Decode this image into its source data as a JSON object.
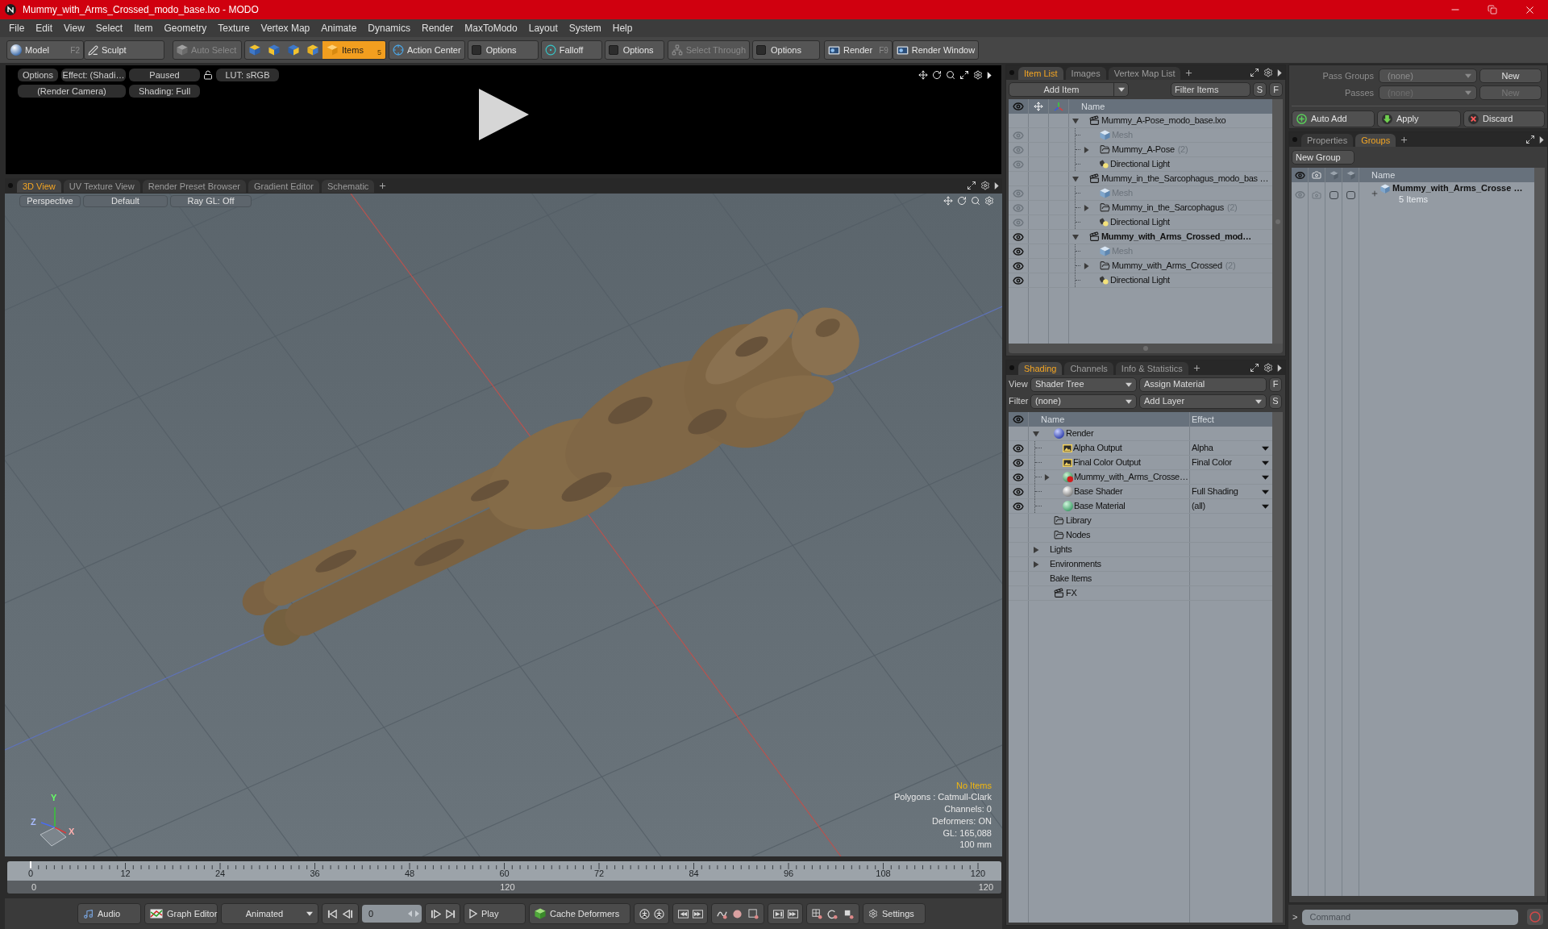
{
  "window": {
    "title": "Mummy_with_Arms_Crossed_modo_base.lxo - MODO"
  },
  "menu": [
    "File",
    "Edit",
    "View",
    "Select",
    "Item",
    "Geometry",
    "Texture",
    "Vertex Map",
    "Animate",
    "Dynamics",
    "Render",
    "MaxToModo",
    "Layout",
    "System",
    "Help"
  ],
  "toolbar": [
    {
      "kind": "button",
      "label": "Model",
      "shortcut": "F2",
      "disabled": false
    },
    {
      "kind": "button",
      "label": "Sculpt",
      "disabled": false
    },
    {
      "kind": "button",
      "label": "Auto Select",
      "disabled": true
    },
    {
      "kind": "modes",
      "items": [
        {
          "selected": false
        },
        {
          "selected": false
        },
        {
          "selected": false
        },
        {
          "selected": false
        },
        {
          "label": "Items",
          "shortcut": "5",
          "selected": true
        }
      ]
    },
    {
      "kind": "button",
      "label": "Action Center",
      "disabled": false
    },
    {
      "kind": "toggle",
      "label": "Options",
      "disabled": false
    },
    {
      "kind": "button",
      "label": "Falloff",
      "disabled": false
    },
    {
      "kind": "toggle",
      "label": "Options",
      "disabled": false
    },
    {
      "kind": "button",
      "label": "Select Through",
      "disabled": true
    },
    {
      "kind": "toggle",
      "label": "Options",
      "disabled": false
    },
    {
      "kind": "button",
      "label": "Render",
      "shortcut": "F9",
      "disabled": false
    },
    {
      "kind": "button",
      "label": "Render Window",
      "disabled": false
    }
  ],
  "preview": {
    "row_1": [
      "Options",
      "Effect: (Shadi…",
      "Paused",
      "LUT: sRGB"
    ],
    "row_2": [
      "(Render Camera)",
      "Shading: Full"
    ]
  },
  "viewport": {
    "tabs": [
      {
        "label": "3D View",
        "selected": true
      },
      {
        "label": "UV Texture View",
        "selected": false
      },
      {
        "label": "Render Preset Browser",
        "selected": false
      },
      {
        "label": "Gradient Editor",
        "selected": false
      },
      {
        "label": "Schematic",
        "selected": false
      }
    ],
    "view_bar": [
      "Perspective",
      "Default",
      "Ray GL: Off"
    ],
    "status": "No Items",
    "info": [
      "Polygons : Catmull-Clark",
      "Channels: 0",
      "Deformers: ON",
      "GL: 165,088",
      "100 mm"
    ],
    "axes": {
      "x": "X",
      "y": "Y",
      "z": "Z"
    }
  },
  "timeline": {
    "ticks": [
      "0",
      "12",
      "24",
      "36",
      "48",
      "60",
      "72",
      "84",
      "96",
      "108",
      "120"
    ],
    "range": [
      "0",
      "120",
      "120"
    ]
  },
  "playback": {
    "audio": "Audio",
    "graph_editor": "Graph Editor",
    "mode": "Animated",
    "frame": "0",
    "play": "Play",
    "cache": "Cache Deformers",
    "settings": "Settings"
  },
  "item_list": {
    "tabs": [
      {
        "label": "Item List",
        "selected": true
      },
      {
        "label": "Images",
        "selected": false
      },
      {
        "label": "Vertex Map List",
        "selected": false
      }
    ],
    "add_item": "Add Item",
    "filter": {
      "placeholder": "Filter Items"
    },
    "filter_buttons": [
      "S",
      "F"
    ],
    "column": "Name",
    "scenes": [
      {
        "label": "Mummy_A-Pose_modo_base.lxo",
        "current": false,
        "expanded": true,
        "children": [
          {
            "kind": "mesh",
            "label": "Mesh",
            "visible": false
          },
          {
            "kind": "group",
            "label": "Mummy_A-Pose",
            "count": "(2)",
            "expanded": false,
            "visible": false
          },
          {
            "kind": "light",
            "label": "Directional Light",
            "visible": false
          }
        ]
      },
      {
        "label": "Mummy_in_the_Sarcophagus_modo_bas …",
        "current": false,
        "expanded": true,
        "children": [
          {
            "kind": "mesh",
            "label": "Mesh",
            "visible": false
          },
          {
            "kind": "group",
            "label": "Mummy_in_the_Sarcophagus",
            "count": "(2)",
            "expanded": false,
            "visible": false
          },
          {
            "kind": "light",
            "label": "Directional Light",
            "visible": false
          }
        ]
      },
      {
        "label": "Mummy_with_Arms_Crossed_mod…",
        "current": true,
        "expanded": true,
        "children": [
          {
            "kind": "mesh",
            "label": "Mesh",
            "visible": true
          },
          {
            "kind": "group",
            "label": "Mummy_with_Arms_Crossed",
            "count": "(2)",
            "expanded": false,
            "visible": true
          },
          {
            "kind": "light",
            "label": "Directional Light",
            "visible": true
          }
        ]
      }
    ]
  },
  "shading": {
    "tabs": [
      {
        "label": "Shading",
        "selected": true
      },
      {
        "label": "Channels",
        "selected": false
      },
      {
        "label": "Info & Statistics",
        "selected": false
      }
    ],
    "view_label": "View",
    "view": "Shader Tree",
    "assign": "Assign Material",
    "view_button": "F",
    "filter_label": "Filter",
    "filter": "(none)",
    "add_layer": "Add Layer",
    "filter_button": "S",
    "columns": [
      "Name",
      "Effect"
    ],
    "rows": [
      {
        "kind": "render",
        "label": "Render",
        "expanded": true,
        "eye": false,
        "children": [
          {
            "kind": "output",
            "label": "Alpha Output",
            "effect": "Alpha",
            "eye": true
          },
          {
            "kind": "output",
            "label": "Final Color Output",
            "effect": "Final Color",
            "eye": true
          },
          {
            "kind": "material_group",
            "label": "Mummy_with_Arms_Crosse…",
            "expanded": false,
            "eye": true
          },
          {
            "kind": "shader",
            "label": "Base Shader",
            "effect": "Full Shading",
            "eye": true
          },
          {
            "kind": "material",
            "label": "Base Material",
            "effect": "(all)",
            "eye": true
          }
        ]
      },
      {
        "kind": "folder",
        "label": "Library",
        "eye": false
      },
      {
        "kind": "folder",
        "label": "Nodes",
        "eye": false
      },
      {
        "kind": "category",
        "label": "Lights",
        "expanded": false,
        "eye": false
      },
      {
        "kind": "category",
        "label": "Environments",
        "expanded": false,
        "eye": false
      },
      {
        "kind": "category",
        "label": "Bake Items",
        "eye": false
      },
      {
        "kind": "fx",
        "label": "FX",
        "eye": false
      }
    ]
  },
  "groups_panel": {
    "pass_groups": {
      "label": "Pass Groups",
      "value": "(none)",
      "button": "New",
      "disabled": false
    },
    "passes": {
      "label": "Passes",
      "value": "(none)",
      "button": "New",
      "disabled": true
    },
    "actions": [
      "Auto Add",
      "Apply",
      "Discard"
    ],
    "tabs": [
      {
        "label": "Properties",
        "selected": false
      },
      {
        "label": "Groups",
        "selected": true
      }
    ],
    "new_group": "New Group",
    "column": "Name",
    "groups": [
      {
        "label": "Mummy_with_Arms_Crosse …",
        "detail": "5 Items"
      }
    ]
  },
  "command": {
    "prompt": ">",
    "placeholder": "Command"
  }
}
